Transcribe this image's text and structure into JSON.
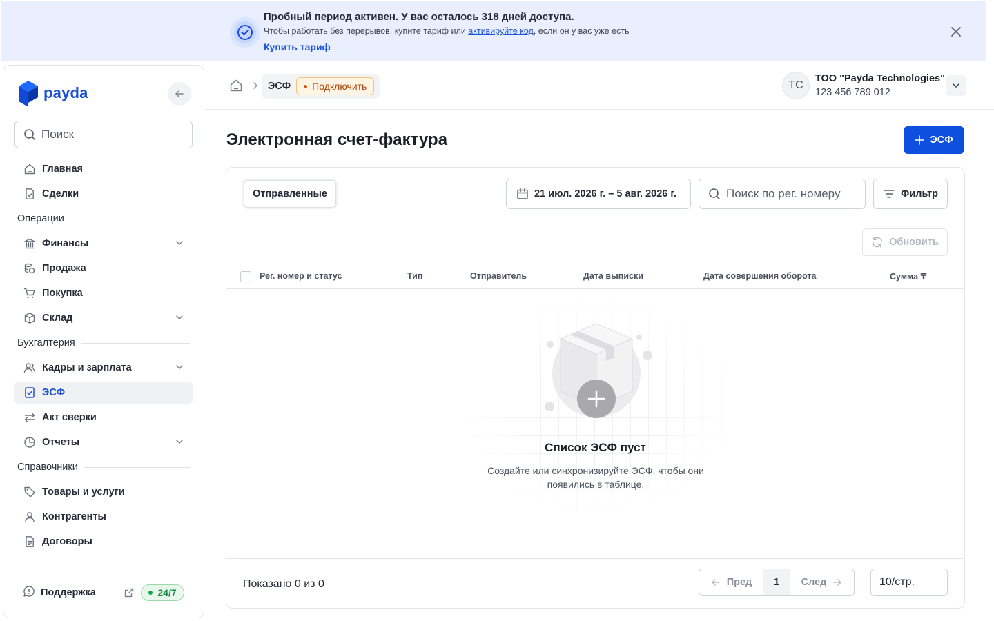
{
  "banner": {
    "title": "Пробный период активен. У вас осталось 318 дней доступа.",
    "text_before": "Чтобы работать без перерывов, купите тариф или ",
    "link_text": "активируйте код",
    "text_after": ", если он у вас уже есть",
    "buy_label": "Купить тариф"
  },
  "sidebar": {
    "logo_text": "payda",
    "search_placeholder": "Поиск",
    "items": [
      {
        "label": "Главная",
        "icon": "home-icon"
      },
      {
        "label": "Сделки",
        "icon": "document-check-icon"
      }
    ],
    "sections": [
      {
        "title": "Операции",
        "items": [
          {
            "label": "Финансы",
            "icon": "bank-icon",
            "expandable": true
          },
          {
            "label": "Продажа",
            "icon": "coins-icon"
          },
          {
            "label": "Покупка",
            "icon": "cart-icon"
          },
          {
            "label": "Склад",
            "icon": "box-icon",
            "expandable": true
          }
        ]
      },
      {
        "title": "Бухгалтерия",
        "items": [
          {
            "label": "Кадры и зарплата",
            "icon": "users-icon",
            "expandable": true
          },
          {
            "label": "ЭСФ",
            "icon": "invoice-icon",
            "active": true
          },
          {
            "label": "Акт сверки",
            "icon": "arrows-swap-icon"
          },
          {
            "label": "Отчеты",
            "icon": "pie-chart-icon",
            "expandable": true
          }
        ]
      },
      {
        "title": "Справочники",
        "items": [
          {
            "label": "Товары и услуги",
            "icon": "tag-icon"
          },
          {
            "label": "Контрагенты",
            "icon": "user-icon"
          },
          {
            "label": "Договоры",
            "icon": "file-text-icon"
          }
        ]
      }
    ],
    "support_label": "Поддержка",
    "support_badge": "24/7"
  },
  "header": {
    "breadcrumb_current": "ЭСФ",
    "connect_label": "Подключить",
    "avatar_initials": "TC",
    "org_name": "ТОО \"Payda Technologies\"",
    "org_id": "123 456 789 012"
  },
  "main": {
    "title": "Электронная счет-фактура",
    "add_button": "ЭСФ",
    "tab_label": "Отправленные",
    "date_range": "21 июл. 2026 г. – 5 авг. 2026 г.",
    "reg_search_placeholder": "Поиск по рег. номеру",
    "filter_label": "Фильтр",
    "refresh_label": "Обновить",
    "columns": [
      "Рег. номер и статус",
      "Тип",
      "Отправитель",
      "Дата выписки",
      "Дата совершения оборота",
      "Сумма ₸"
    ],
    "empty_title": "Список ЭСФ пуст",
    "empty_desc": "Создайте или синхронизируйте ЭСФ, чтобы они появились в таблице.",
    "shown_text": "Показано 0 из 0",
    "pager": {
      "prev": "Пред",
      "current": "1",
      "next": "След"
    },
    "per_page": "10/стр."
  },
  "colors": {
    "accent": "#0e4fe0",
    "brand": "#1a4fd6",
    "banner_bg": "#e9efff",
    "warning": "#d6560f",
    "success": "#18a34a"
  }
}
